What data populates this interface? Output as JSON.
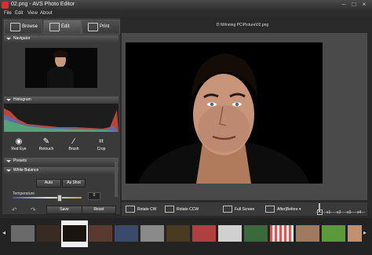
{
  "window": {
    "title": "02.png - AVS Photo Editor",
    "icon": "app-icon"
  },
  "menu": [
    "File",
    "Edit",
    "View",
    "About"
  ],
  "tabs": [
    {
      "label": "Browse",
      "icon": "browse-icon"
    },
    {
      "label": "Edit",
      "icon": "edit-icon"
    },
    {
      "label": "Print",
      "icon": "print-icon"
    }
  ],
  "sections": {
    "navigator": "Navigator",
    "histogram": "Histogram",
    "presets": "Presets",
    "white_balance": "White Balance"
  },
  "tools": [
    {
      "label": "Red Eye",
      "icon": "red-eye-icon"
    },
    {
      "label": "Retouch",
      "icon": "retouch-icon"
    },
    {
      "label": "Brush",
      "icon": "brush-icon"
    },
    {
      "label": "Crop",
      "icon": "crop-icon"
    }
  ],
  "white_balance": {
    "auto": "Auto",
    "as_shot": "As Shot",
    "temperature_label": "Temperature",
    "temperature_value": "0"
  },
  "actions": {
    "save": "Save",
    "reset": "Reset"
  },
  "file_path": "D:\\Winning PC\\Picture\\02.png",
  "bottom_toolbar": {
    "rotate_cw": "Rotate CW",
    "rotate_ccw": "Rotate CCW",
    "full_screen": "Full Screen",
    "after_before": "After|Before"
  },
  "zoom_levels": [
    "x1",
    "x2",
    "x3",
    "x4"
  ],
  "colors": {
    "accent": "#6a6a6a",
    "background": "#2a2a2a"
  }
}
